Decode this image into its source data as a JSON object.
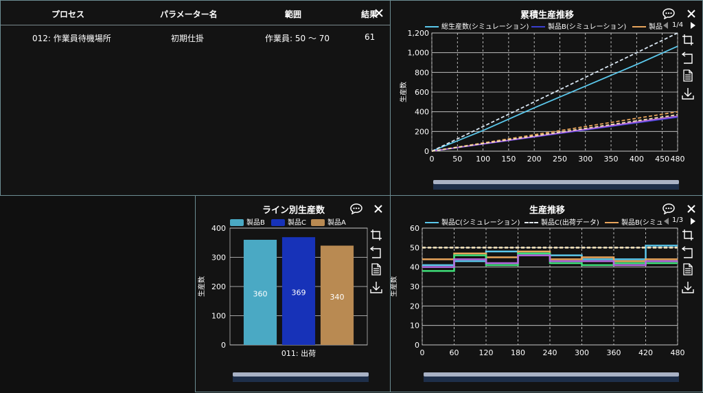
{
  "table": {
    "headers": [
      "プロセス",
      "パラメーター名",
      "範囲",
      "結果"
    ],
    "rows": [
      [
        "012: 作業員待機場所",
        "初期仕掛",
        "作業員: 50 〜 70",
        "61"
      ]
    ]
  },
  "icons": {
    "close": "close-icon",
    "comment": "comment-icon",
    "crop": "crop-icon",
    "undo": "undo-icon",
    "document": "document-icon",
    "download": "download-icon"
  },
  "cumulative": {
    "title": "累積生産推移",
    "legend": [
      "総生産数(シミュレーション)",
      "製品B(シミュレーション)",
      "製品"
    ],
    "page": "1/4",
    "ylabel": "生産数"
  },
  "line_prod": {
    "title": "ライン別生産数",
    "ylabel": "生産数"
  },
  "prod_trend": {
    "title": "生産推移",
    "legend": [
      "製品C(シミュレーション)",
      "製品C(出荷データ)",
      "製品B(シミュ"
    ],
    "page": "1/3",
    "ylabel": "生産数"
  },
  "chart_data": [
    {
      "type": "line",
      "title": "累積生産推移",
      "ylabel": "生産数",
      "xlim": [
        0,
        480
      ],
      "ylim": [
        0,
        1200
      ],
      "xticks": [
        0,
        50,
        100,
        150,
        200,
        250,
        300,
        350,
        400,
        450,
        480
      ],
      "yticks": [
        "0",
        "200",
        "400",
        "600",
        "800",
        "1,000",
        "1,200"
      ],
      "ytick_values": [
        0,
        200,
        400,
        600,
        800,
        1000,
        1200
      ],
      "series": [
        {
          "name": "総生産数(シミュレーション)",
          "color": "#5bc8ec",
          "dash": false,
          "x": [
            0,
            100,
            200,
            300,
            400,
            480
          ],
          "y": [
            0,
            210,
            440,
            660,
            880,
            1065
          ]
        },
        {
          "name": "",
          "color": "#dce9f5",
          "dash": true,
          "x": [
            0,
            480
          ],
          "y": [
            0,
            1200
          ]
        },
        {
          "name": "製品B(シミュレーション)",
          "color": "#3b3fd0",
          "dash": false,
          "x": [
            0,
            480
          ],
          "y": [
            0,
            345
          ]
        },
        {
          "name": "",
          "color": "#b56ae0",
          "dash": false,
          "x": [
            0,
            480
          ],
          "y": [
            0,
            355
          ]
        },
        {
          "name": "",
          "color": "#e9a55c",
          "dash": true,
          "x": [
            0,
            480
          ],
          "y": [
            0,
            400
          ]
        },
        {
          "name": "",
          "color": "#f3e0b5",
          "dash": true,
          "x": [
            0,
            480
          ],
          "y": [
            0,
            370
          ]
        }
      ]
    },
    {
      "type": "bar",
      "title": "ライン別生産数",
      "ylabel": "生産数",
      "categories": [
        "011: 出荷"
      ],
      "ylim": [
        0,
        400
      ],
      "yticks": [
        "0",
        "100",
        "200",
        "300",
        "400"
      ],
      "ytick_values": [
        0,
        100,
        200,
        300,
        400
      ],
      "series": [
        {
          "name": "製品B",
          "values": [
            360
          ],
          "color": "#4aa9c4"
        },
        {
          "name": "製品C",
          "values": [
            369
          ],
          "color": "#1732b8"
        },
        {
          "name": "製品A",
          "values": [
            340
          ],
          "color": "#b98a52"
        }
      ]
    },
    {
      "type": "line",
      "title": "生産推移",
      "ylabel": "生産数",
      "xlim": [
        0,
        480
      ],
      "ylim": [
        0,
        60
      ],
      "xticks": [
        0,
        60,
        120,
        180,
        240,
        300,
        360,
        420,
        480
      ],
      "yticks": [
        "0",
        "10",
        "20",
        "30",
        "40",
        "50",
        "60"
      ],
      "ytick_values": [
        0,
        10,
        20,
        30,
        40,
        50,
        60
      ],
      "step": true,
      "series": [
        {
          "name": "製品C(シミュレーション)",
          "color": "#5bc8ec",
          "dash": false,
          "x": [
            0,
            60,
            120,
            180,
            240,
            300,
            360,
            420,
            480
          ],
          "y": [
            41,
            43,
            48,
            47,
            46,
            44,
            44,
            51,
            51
          ]
        },
        {
          "name": "製品C(出荷データ)",
          "color": "#e6eef7",
          "dash": true,
          "x": [
            0,
            480
          ],
          "y": [
            50,
            50
          ]
        },
        {
          "name": "製品B(シミュ",
          "color": "#e9a55c",
          "dash": false,
          "x": [
            0,
            60,
            120,
            180,
            240,
            300,
            360,
            420,
            480
          ],
          "y": [
            44,
            47,
            45,
            48,
            44,
            45,
            43,
            44,
            44
          ]
        },
        {
          "name": "",
          "color": "#f3e0b5",
          "dash": true,
          "x": [
            0,
            480
          ],
          "y": [
            50,
            50
          ]
        },
        {
          "name": "",
          "color": "#3fe07a",
          "dash": false,
          "x": [
            0,
            60,
            120,
            180,
            240,
            300,
            360,
            420,
            480
          ],
          "y": [
            38,
            46,
            41,
            47,
            42,
            41,
            42,
            42,
            42
          ]
        },
        {
          "name": "",
          "color": "#b56ae0",
          "dash": false,
          "x": [
            0,
            60,
            120,
            180,
            240,
            300,
            360,
            420,
            480
          ],
          "y": [
            40,
            44,
            42,
            46,
            43,
            43,
            41,
            43,
            43
          ]
        }
      ]
    }
  ]
}
